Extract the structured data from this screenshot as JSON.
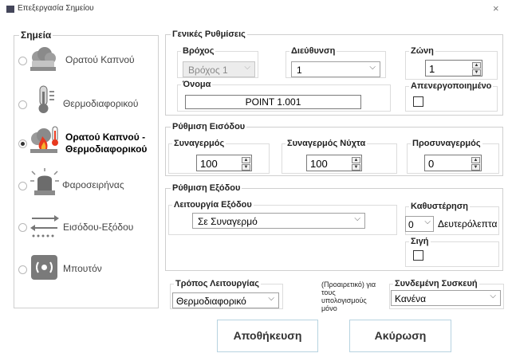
{
  "window": {
    "title": "Επεξεργασία Σημείου",
    "close_glyph": "×"
  },
  "sensors": {
    "legend": "Σημεία",
    "items": [
      {
        "label": "Ορατού Καπνού",
        "icon": "smoke-detector-icon",
        "selected": false
      },
      {
        "label": "Θερμοδιαφορικού",
        "icon": "thermometer-icon",
        "selected": false
      },
      {
        "label": "Ορατού Καπνού -",
        "label2": "Θερμοδιαφορικού",
        "icon": "smoke-heat-detector-icon",
        "selected": true
      },
      {
        "label": "Φαροσειρήνας",
        "icon": "siren-beacon-icon",
        "selected": false
      },
      {
        "label": "Εισόδου-Εξόδου",
        "icon": "input-output-icon",
        "selected": false
      },
      {
        "label": "Μπουτόν",
        "icon": "push-button-icon",
        "selected": false
      }
    ]
  },
  "general": {
    "legend": "Γενικές Ρυθμίσεις",
    "loop": {
      "legend": "Βρόχος",
      "value": "Βρόχος 1",
      "disabled": true
    },
    "address": {
      "legend": "Διεύθυνση",
      "value": "1"
    },
    "zone": {
      "legend": "Ζώνη",
      "value": "1"
    },
    "name": {
      "legend": "Όνομα",
      "value": "POINT  1.001"
    },
    "disabled_flag": {
      "legend": "Απενεργοποιημένο",
      "checked": false
    }
  },
  "input": {
    "legend": "Ρύθμιση Εισόδου",
    "alarm": {
      "legend": "Συναγερμός",
      "value": "100"
    },
    "night_alarm": {
      "legend": "Συναγερμός Νύχτα",
      "value": "100"
    },
    "pre_alarm": {
      "legend": "Προσυναγερμός",
      "value": "0"
    }
  },
  "output": {
    "legend": "Ρύθμιση Εξόδου",
    "function": {
      "legend": "Λειτουργία Εξόδου",
      "value": "Σε Συναγερμό"
    },
    "delay": {
      "legend": "Καθυστέρηση",
      "value": "0",
      "unit": "Δευτερόλεπτα"
    },
    "silent": {
      "legend": "Σιγή",
      "checked": false
    }
  },
  "mode": {
    "legend": "Τρόπος Λειτουργίας",
    "value": "Θερμοδιαφορικό"
  },
  "optional_note": {
    "line1": "(Προαιρετικό) για",
    "line2": "τους",
    "line3": "υπολογισμούς",
    "line4": "μόνο"
  },
  "linked_device": {
    "legend": "Συνδεμένη Συσκευή",
    "value": "Κανένα"
  },
  "buttons": {
    "save": "Αποθήκευση",
    "cancel": "Ακύρωση"
  },
  "colors": {
    "fire": "#e8391f",
    "icon_gray": "#7a7a7a",
    "button_border": "#b7d3e0"
  }
}
